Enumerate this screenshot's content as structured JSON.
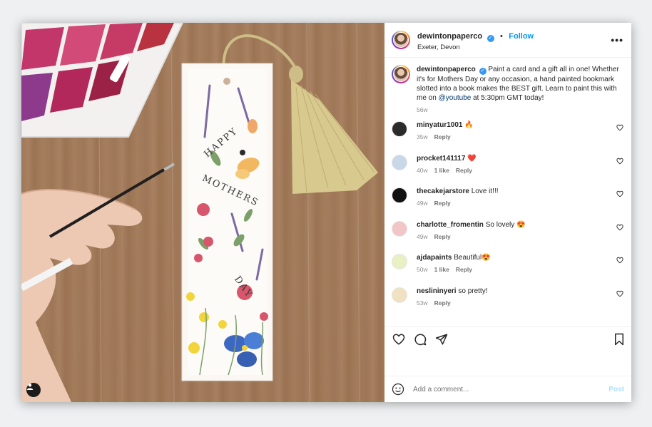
{
  "header": {
    "username": "dewintonpaperco",
    "verified": true,
    "separator": "•",
    "follow_label": "Follow",
    "location": "Exeter, Devon",
    "more_icon": "more-horizontal-icon"
  },
  "caption": {
    "username": "dewintonpaperco",
    "text_before_mention": "Paint a card and a gift all in one! Whether it's for Mothers Day or any occasion, a hand painted bookmark slotted into a book makes the BEST gift. Learn to paint this with me on ",
    "mention": "@youtube",
    "text_after_mention": " at 5:30pm GMT today!",
    "age": "56w"
  },
  "comments": [
    {
      "username": "minyatur1001",
      "text": "🔥",
      "age": "35w",
      "likes": "",
      "reply": "Reply",
      "avatar_color": "#2b2b2b"
    },
    {
      "username": "procket141117",
      "text": "❤️",
      "age": "40w",
      "likes": "1 like",
      "reply": "Reply",
      "avatar_color": "#c9d8e8"
    },
    {
      "username": "thecakejarstore",
      "text": "Love it!!!",
      "age": "49w",
      "likes": "",
      "reply": "Reply",
      "avatar_color": "#111111"
    },
    {
      "username": "charlotte_fromentin",
      "text": "So lovely 😍",
      "age": "49w",
      "likes": "",
      "reply": "Reply",
      "avatar_color": "#f2c6c6"
    },
    {
      "username": "ajdapaints",
      "text": "Beautiful😍",
      "age": "50w",
      "likes": "1 like",
      "reply": "Reply",
      "avatar_color": "#e9f0c4"
    },
    {
      "username": "neslininyeri",
      "text": "so pretty!",
      "age": "53w",
      "likes": "",
      "reply": "Reply",
      "avatar_color": "#f0e2c0"
    }
  ],
  "actions": {
    "like_icon": "heart-icon",
    "comment_icon": "comment-icon",
    "share_icon": "send-icon",
    "save_icon": "bookmark-icon"
  },
  "add_comment": {
    "placeholder": "Add a comment...",
    "post_label": "Post",
    "emoji_icon": "smiley-icon"
  },
  "photo": {
    "bookmark_text": [
      "HAPPY",
      "MOTHERS",
      "DAY"
    ],
    "user_tag_icon": "person-icon"
  },
  "colors": {
    "accent": "#0095f6",
    "verified": "#3897f0",
    "text": "#262626",
    "secondary": "#8e8e8e"
  }
}
